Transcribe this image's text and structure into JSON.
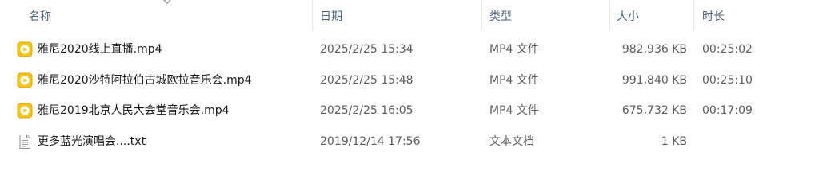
{
  "columns": {
    "name": "名称",
    "date": "日期",
    "type": "类型",
    "size": "大小",
    "duration": "时长"
  },
  "files": [
    {
      "name": "雅尼2020线上直播.mp4",
      "date": "2025/2/25 15:34",
      "type": "MP4 文件",
      "size": "982,936 KB",
      "duration": "00:25:02",
      "icon": "video-file-icon"
    },
    {
      "name": "雅尼2020沙特阿拉伯古城欧拉音乐会.mp4",
      "date": "2025/2/25 15:48",
      "type": "MP4 文件",
      "size": "991,840 KB",
      "duration": "00:25:10",
      "icon": "video-file-icon"
    },
    {
      "name": "雅尼2019北京人民大会堂音乐会.mp4",
      "date": "2025/2/25 16:05",
      "type": "MP4 文件",
      "size": "675,732 KB",
      "duration": "00:17:09",
      "icon": "video-file-icon"
    },
    {
      "name": "更多蓝光演唱会....txt",
      "date": "2019/12/14 17:56",
      "type": "文本文档",
      "size": "1 KB",
      "duration": "",
      "icon": "text-file-icon"
    }
  ],
  "colors": {
    "header_text": "#4c607a",
    "video_icon": "#f5c518",
    "text": "#1a1a1a"
  }
}
